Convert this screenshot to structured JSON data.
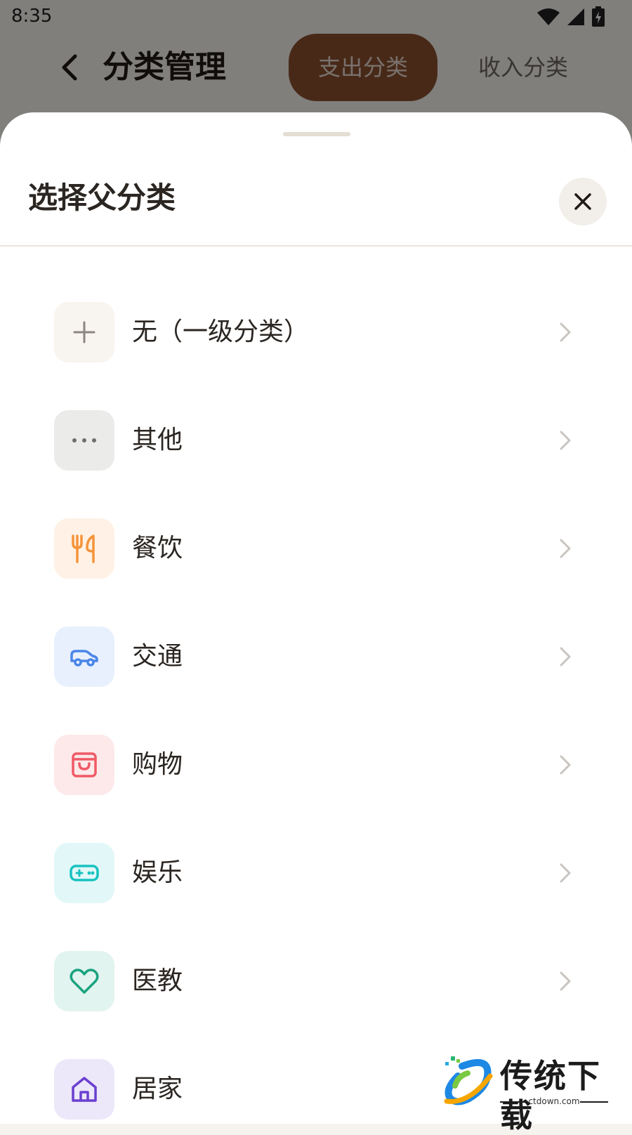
{
  "status_bar": {
    "time": "8:35"
  },
  "header": {
    "title": "分类管理",
    "tabs": [
      {
        "label": "支出分类",
        "active": true
      },
      {
        "label": "收入分类",
        "active": false
      }
    ]
  },
  "sheet": {
    "title": "选择父分类",
    "items": [
      {
        "label": "无（一级分类）",
        "icon": "plus-icon",
        "bg": "#f8f4ef",
        "color": "#8c8580"
      },
      {
        "label": "其他",
        "icon": "more-icon",
        "bg": "#ebebea",
        "color": "#6e6e6e"
      },
      {
        "label": "餐饮",
        "icon": "fork-knife-icon",
        "bg": "#fff1e5",
        "color": "#f5943a"
      },
      {
        "label": "交通",
        "icon": "car-icon",
        "bg": "#e8f0fe",
        "color": "#4a86e8"
      },
      {
        "label": "购物",
        "icon": "shopping-bag-icon",
        "bg": "#fde9ea",
        "color": "#ef5a66"
      },
      {
        "label": "娱乐",
        "icon": "gamepad-icon",
        "bg": "#e2f8f8",
        "color": "#18c2c0"
      },
      {
        "label": "医教",
        "icon": "heart-icon",
        "bg": "#e1f4ef",
        "color": "#1aa37f"
      },
      {
        "label": "居家",
        "icon": "home-icon",
        "bg": "#ede7fa",
        "color": "#6a3fd0"
      }
    ]
  },
  "watermark": {
    "title": "传统下载",
    "subtitle": "ctdown.com"
  }
}
